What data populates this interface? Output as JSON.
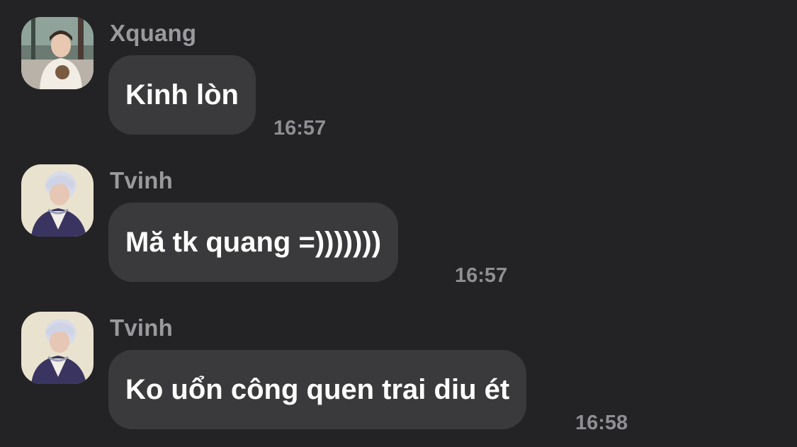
{
  "messages": [
    {
      "sender": "Xquang",
      "text": "Kinh lòn",
      "time": "16:57",
      "avatar_icon": "user-avatar-photo"
    },
    {
      "sender": "Tvinh",
      "text": "Mă tk quang =)))))))",
      "time": "16:57",
      "avatar_icon": "user-avatar-photo"
    },
    {
      "sender": "Tvinh",
      "text": "Ko uổn công quen trai diu ét",
      "time": "16:58",
      "avatar_icon": "user-avatar-photo"
    }
  ],
  "colors": {
    "background": "#232325",
    "bubble": "#3a3a3c",
    "sender_name": "#9a9a9e",
    "timestamp": "#8e8e93",
    "message_text": "#ffffff"
  }
}
